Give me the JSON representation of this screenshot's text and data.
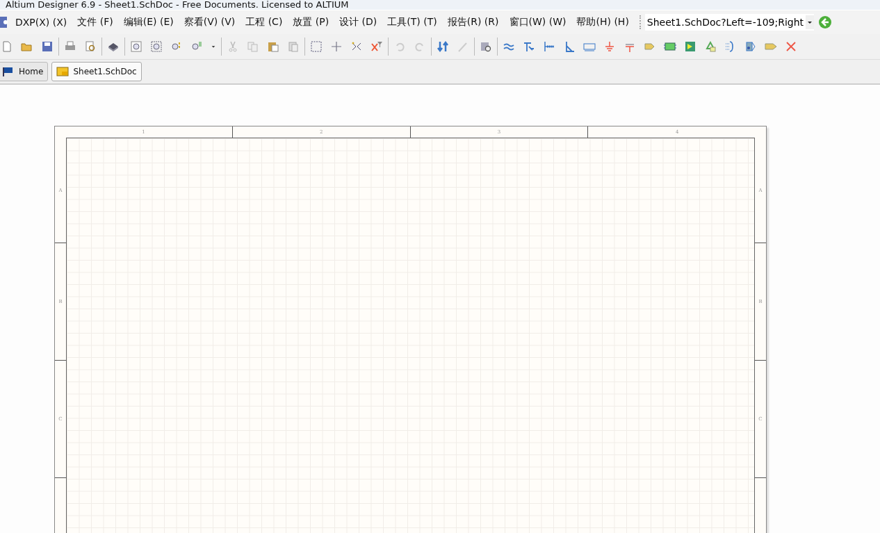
{
  "window": {
    "title": "Altium Designer 6.9 - Sheet1.SchDoc - Free Documents. Licensed to ALTIUM"
  },
  "menu": [
    "DXP(X) (X)",
    "文件 (F)",
    "编辑(E) (E)",
    "察看(V) (V)",
    "工程 (C)",
    "放置 (P)",
    "设计 (D)",
    "工具(T) (T)",
    "报告(R) (R)",
    "窗口(W) (W)",
    "帮助(H) (H)"
  ],
  "address": {
    "value": "Sheet1.SchDoc?Left=-109;Right"
  },
  "tabs": [
    {
      "label": "Home",
      "kind": "home",
      "selected": false
    },
    {
      "label": "Sheet1.SchDoc",
      "kind": "sheet",
      "selected": true
    }
  ],
  "sheet": {
    "columns": [
      "1",
      "2",
      "3",
      "4"
    ],
    "rows_left": [
      "A",
      "B",
      "C"
    ],
    "rows_right": [
      "A",
      "B",
      "C"
    ]
  }
}
